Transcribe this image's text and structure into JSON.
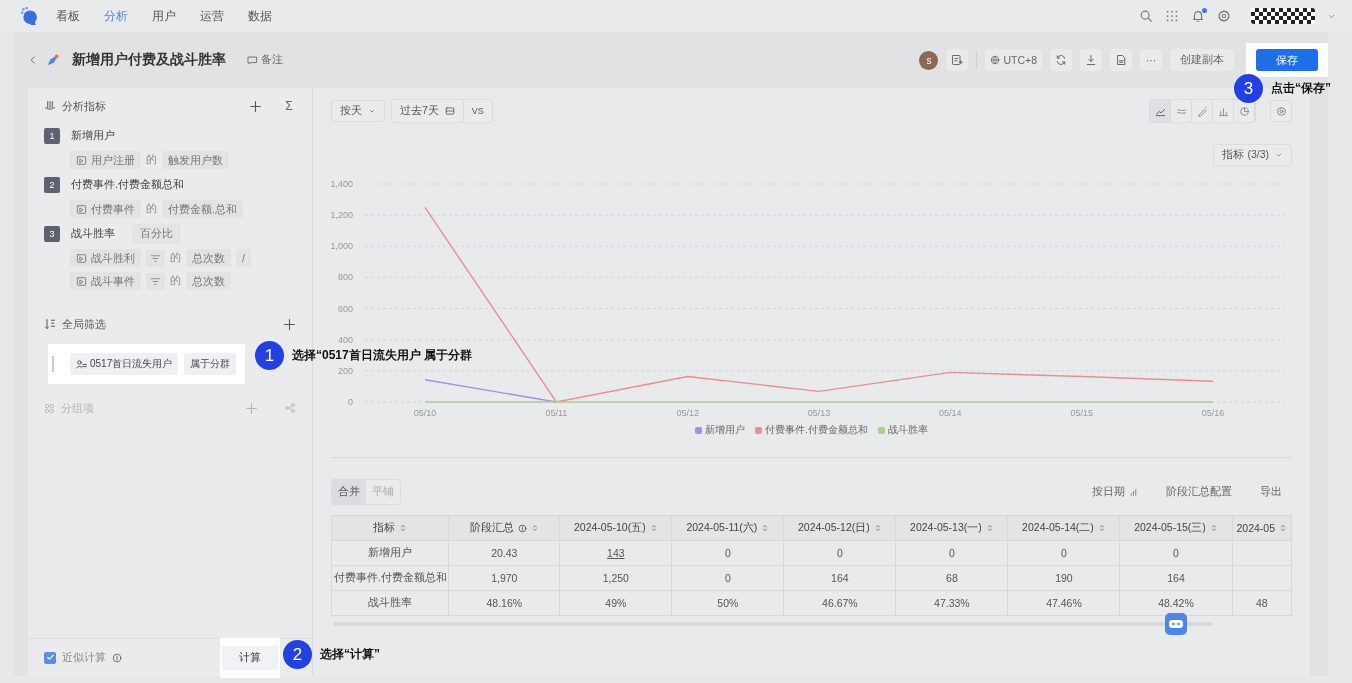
{
  "nav": {
    "items": [
      {
        "label": "看板",
        "selected": false
      },
      {
        "label": "分析",
        "selected": true
      },
      {
        "label": "用户",
        "selected": false
      },
      {
        "label": "运营",
        "selected": false
      },
      {
        "label": "数据",
        "selected": false
      }
    ],
    "notification": true
  },
  "header": {
    "title": "新增用户付费及战斗胜率",
    "note": "备注",
    "owner_initial": "s",
    "timezone": "UTC+8",
    "more": "···",
    "copy_button": "创建副本",
    "save_button": "保存"
  },
  "metrics_panel": {
    "title": "分析指标",
    "sum": "Σ",
    "metrics": [
      {
        "index": "1",
        "name": "新增用户",
        "rows": [
          {
            "event": "用户注册",
            "filter": false,
            "of": "的",
            "measure": "触发用户数"
          }
        ]
      },
      {
        "index": "2",
        "name": "付费事件.付费金额总和",
        "rows": [
          {
            "event": "付费事件",
            "filter": false,
            "of": "的",
            "measure": "付费金额.总和"
          }
        ]
      },
      {
        "index": "3",
        "name": "战斗胜率",
        "tag": "百分比",
        "rows": [
          {
            "event": "战斗胜利",
            "filter": true,
            "of": "的",
            "measure": "总次数",
            "operator": "/"
          },
          {
            "event": "战斗事件",
            "filter": true,
            "of": "的",
            "measure": "总次数"
          }
        ]
      }
    ]
  },
  "global_filter": {
    "title": "全局筛选",
    "segment": "0517首日流失用户",
    "relation": "属于分群"
  },
  "grouping": {
    "title": "分组项",
    "disabled": true
  },
  "footer": {
    "approximate": {
      "label": "近似计算",
      "checked": true
    },
    "compute_button": "计算"
  },
  "toolbar": {
    "granularity": "按天",
    "range": "过去7天",
    "compare": "VS",
    "chart_types": [
      {
        "kind": "line",
        "selected": true
      },
      {
        "kind": "area",
        "selected": false
      },
      {
        "kind": "trend",
        "selected": false
      },
      {
        "kind": "bar",
        "selected": false
      },
      {
        "kind": "pie",
        "selected": false
      }
    ]
  },
  "metric_selector": "指标 (3/3)",
  "chart_data": {
    "type": "line",
    "grid": true,
    "categories": [
      "05/10",
      "05/11",
      "05/12",
      "05/13",
      "05/14",
      "05/15",
      "05/16"
    ],
    "ylim": [
      0,
      1400
    ],
    "yticks": [
      0,
      200,
      400,
      600,
      800,
      {
        "value": 1000,
        "label": "1,000"
      },
      {
        "value": 1200,
        "label": "1,200"
      },
      {
        "value": 1400,
        "label": "1,400"
      }
    ],
    "series": [
      {
        "name": "新增用户",
        "color": "#a98ee0",
        "values": [
          143,
          0,
          null,
          null,
          null,
          null,
          null
        ]
      },
      {
        "name": "付费事件.付费金额总和",
        "color": "#e8908c",
        "values": [
          1250,
          0,
          164,
          68,
          190,
          164,
          133
        ]
      },
      {
        "name": "战斗胜率",
        "color": "#a8cf8c",
        "values": [
          0,
          0,
          0,
          0,
          0,
          0,
          0
        ]
      }
    ]
  },
  "table_view": {
    "tabs": [
      {
        "label": "合并",
        "selected": true
      },
      {
        "label": "平铺",
        "selected": false
      }
    ],
    "by_date": "按日期",
    "summary_config": "阶段汇总配置",
    "export": "导出"
  },
  "table": {
    "columns": [
      {
        "label": "指标",
        "info": false
      },
      {
        "label": "阶段汇总",
        "info": true
      },
      {
        "label": "2024-05-10(五)",
        "info": false
      },
      {
        "label": "2024-05-11(六)",
        "info": false
      },
      {
        "label": "2024-05-12(日)",
        "info": false
      },
      {
        "label": "2024-05-13(一)",
        "info": false
      },
      {
        "label": "2024-05-14(二)",
        "info": false
      },
      {
        "label": "2024-05-15(三)",
        "info": false
      },
      {
        "label": "2024-05",
        "info": false
      }
    ],
    "rows": [
      {
        "cells": [
          "新增用户",
          "20.43",
          {
            "text": "143",
            "link": true
          },
          "0",
          "0",
          "0",
          "0",
          "0"
        ]
      },
      {
        "cells": [
          "付费事件.付费金额总和",
          "1,970",
          "1,250",
          "0",
          "164",
          "68",
          "190",
          "164"
        ]
      },
      {
        "cells": [
          "战斗胜率",
          "48.16%",
          "49%",
          "50%",
          "46.67%",
          "47.33%",
          "47.46%",
          "48.42%",
          "48"
        ]
      }
    ]
  },
  "callouts": [
    {
      "number": "1",
      "text": "选择“0517首日流失用户 属于分群"
    },
    {
      "number": "2",
      "text": "选择“计算”"
    },
    {
      "number": "3",
      "text": "点击“保存”"
    }
  ]
}
